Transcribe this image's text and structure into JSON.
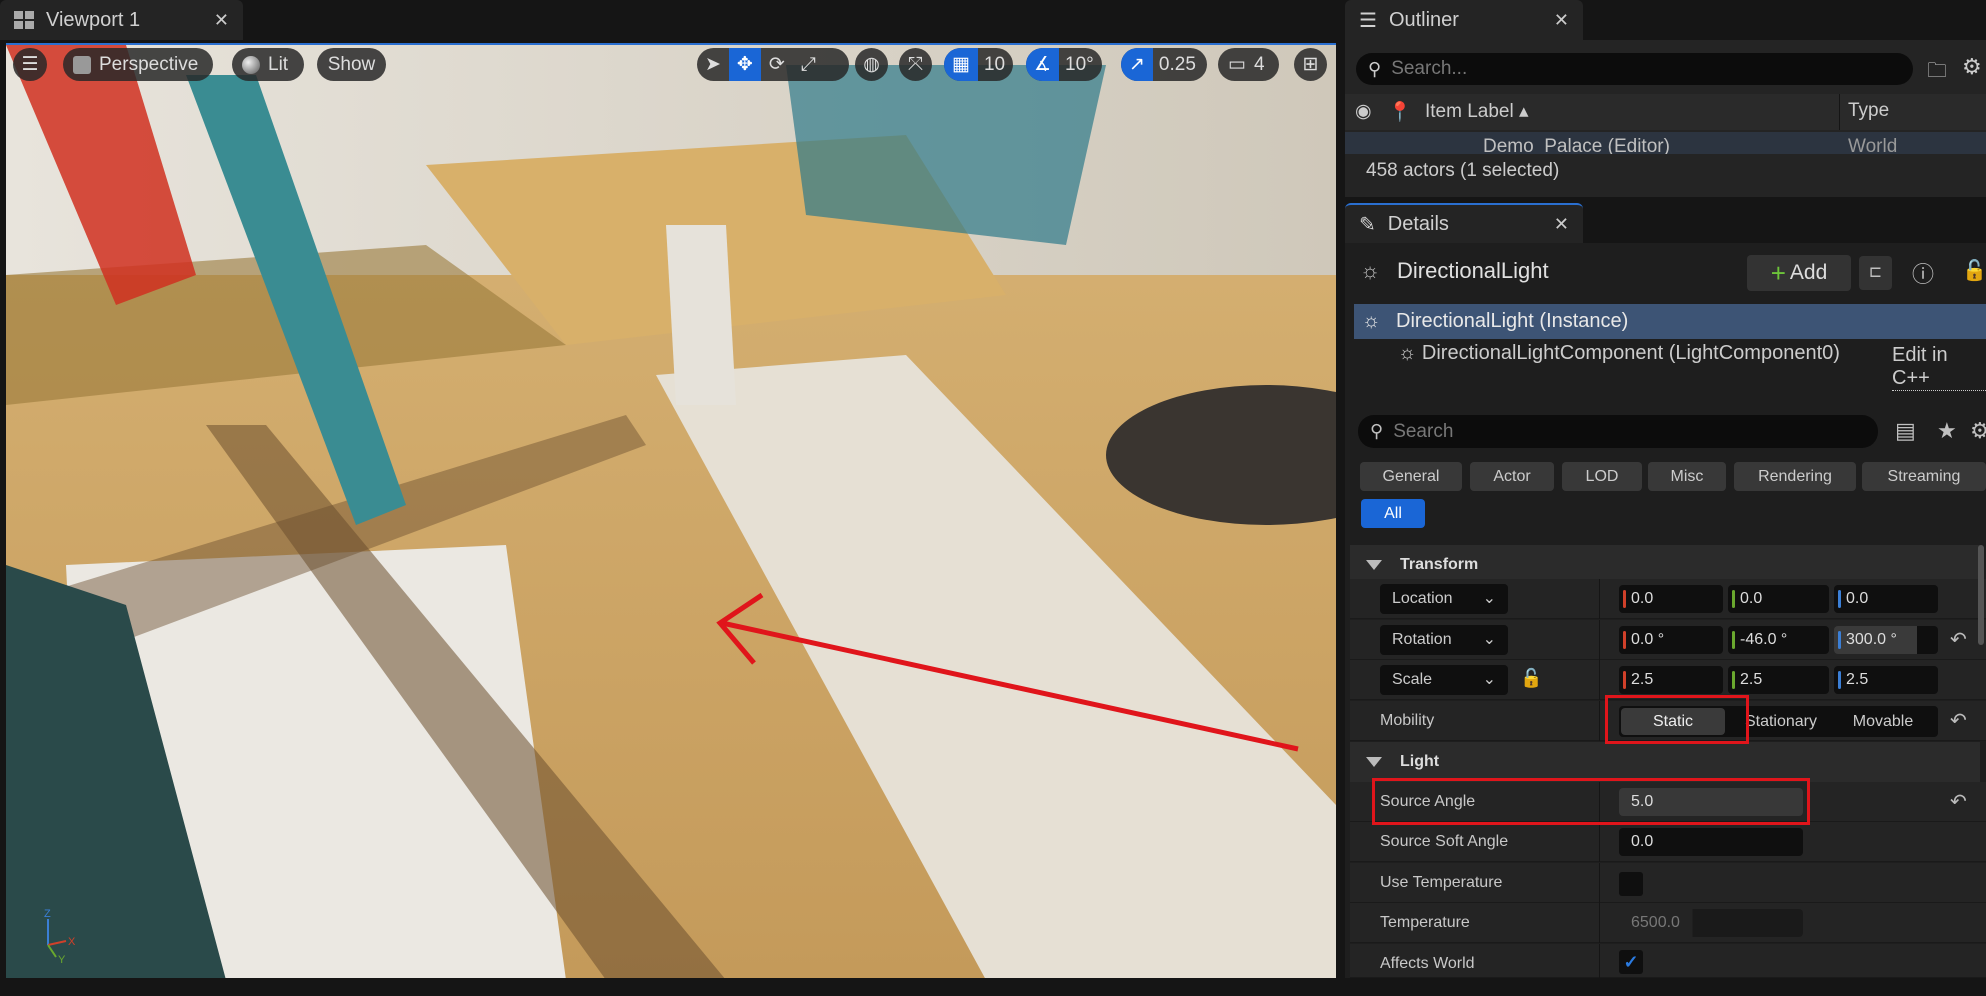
{
  "viewport": {
    "tab_label": "Viewport 1",
    "menu_icon": "hamburger-icon",
    "view_mode": "Perspective",
    "lighting": "Lit",
    "show": "Show",
    "grid_snap": "10",
    "rotation_snap": "10°",
    "scale_snap": "0.25",
    "camera_speed": "4",
    "axis": {
      "x": "X",
      "y": "Y",
      "z": "Z"
    }
  },
  "outliner": {
    "tab_label": "Outliner",
    "search_placeholder": "Search...",
    "col_label": "Item Label",
    "col_type": "Type",
    "rows": [
      {
        "label": "Demo_Palace (Editor)",
        "type": "World"
      }
    ],
    "status": "458 actors (1 selected)"
  },
  "details": {
    "tab_label": "Details",
    "actor": "DirectionalLight",
    "add_label": "Add",
    "instance": "DirectionalLight (Instance)",
    "component": "DirectionalLightComponent (LightComponent0)",
    "edit_link": "Edit in C++",
    "search_placeholder": "Search",
    "filters": [
      "General",
      "Actor",
      "LOD",
      "Misc",
      "Rendering",
      "Streaming"
    ],
    "filter_all": "All",
    "transform": {
      "title": "Transform",
      "location": {
        "label": "Location",
        "values": [
          "0.0",
          "0.0",
          "0.0"
        ]
      },
      "rotation": {
        "label": "Rotation",
        "values": [
          "0.0 °",
          "-46.0 °",
          "300.0 °"
        ]
      },
      "scale": {
        "label": "Scale",
        "values": [
          "2.5",
          "2.5",
          "2.5"
        ]
      },
      "mobility": {
        "label": "Mobility",
        "options": [
          "Static",
          "Stationary",
          "Movable"
        ],
        "selected": "Static"
      }
    },
    "light": {
      "title": "Light",
      "source_angle": {
        "label": "Source Angle",
        "value": "5.0"
      },
      "source_soft_angle": {
        "label": "Source Soft Angle",
        "value": "0.0"
      },
      "use_temperature": {
        "label": "Use Temperature",
        "checked": false
      },
      "temperature": {
        "label": "Temperature",
        "value": "6500.0"
      },
      "affects_world": {
        "label": "Affects World",
        "checked": true
      }
    }
  },
  "colors": {
    "accent": "#1a66d6",
    "annotation": "#e0151b",
    "x_axis": "#d0402a",
    "y_axis": "#6aa82e",
    "z_axis": "#3b7fd6"
  }
}
